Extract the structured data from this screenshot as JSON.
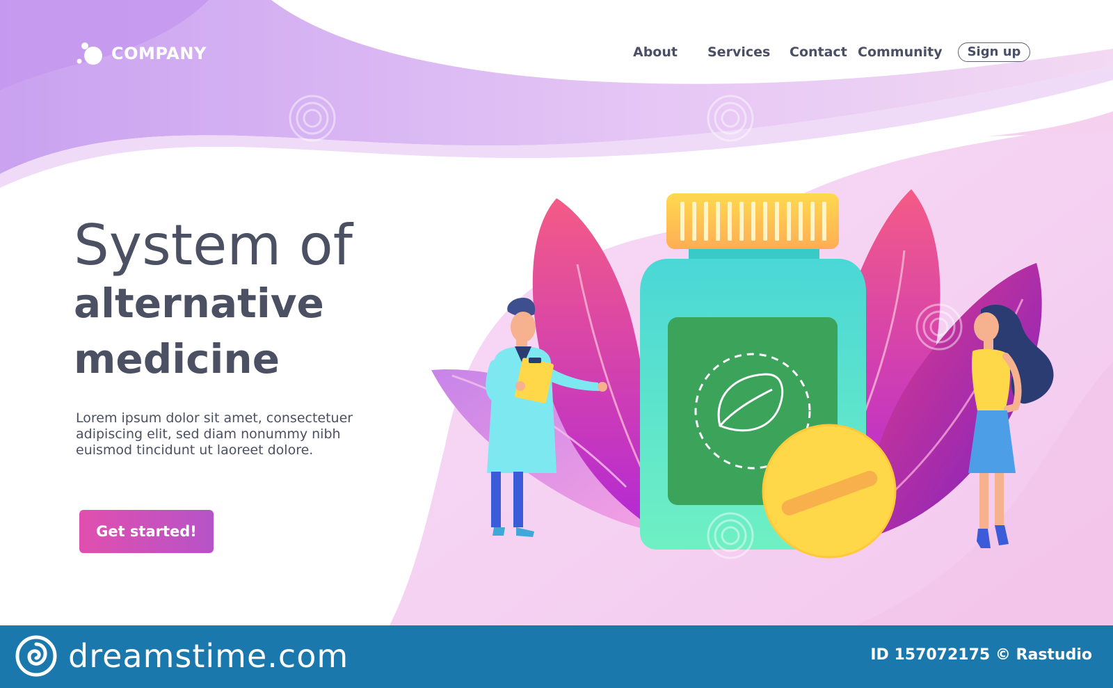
{
  "brand": {
    "name": "COMPANY",
    "logo_icon": "bubble-logo-icon"
  },
  "nav": {
    "items": [
      {
        "label": "About"
      },
      {
        "label": "Services"
      },
      {
        "label": "Contact"
      },
      {
        "label": "Community"
      }
    ],
    "signup_label": "Sign up"
  },
  "hero": {
    "title_line1": "System of",
    "title_line2": "alternative",
    "title_line3": "medicine",
    "description_line1": "Lorem ipsum dolor sit amet, consectetuer",
    "description_line2": "adipiscing elit, sed diam nonummy nibh",
    "description_line3": "euismod tincidunt ut laoreet dolore.",
    "cta_label": "Get started!"
  },
  "footer": {
    "site": "dreamstime.com",
    "image_id": "ID 157072175 © Rastudio",
    "watermark": "dreamstime"
  },
  "colors": {
    "header_purple": "#d9b8f3",
    "accent_pink": "#e14fae",
    "text_dark": "#4b5062",
    "bottle_teal": "#4ee3cf",
    "label_green": "#3aa35a",
    "cap_yellow": "#ffc24b",
    "footer_blue": "#1a78ad"
  }
}
